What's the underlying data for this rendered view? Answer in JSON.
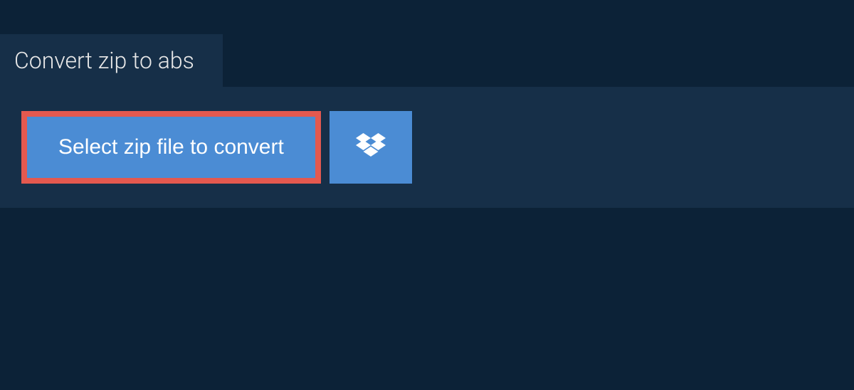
{
  "tab": {
    "title": "Convert zip to abs"
  },
  "actions": {
    "select_file_label": "Select zip file to convert",
    "dropbox_icon_name": "dropbox-icon"
  },
  "colors": {
    "highlight_border": "#e4594f",
    "button_bg": "#4b8cd4",
    "panel_bg": "#162f48",
    "page_bg": "#0c2237"
  }
}
